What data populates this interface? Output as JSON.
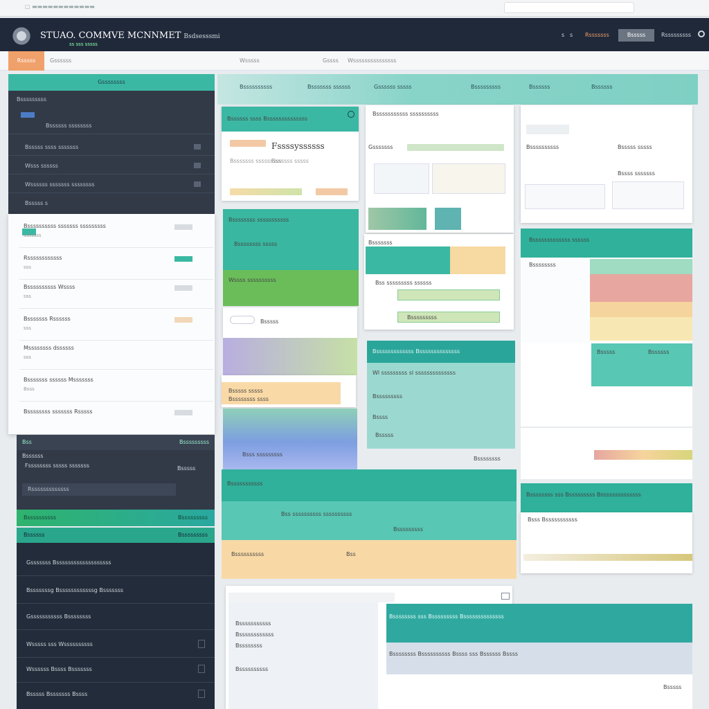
{
  "browser": {
    "url": "▢ ▬▬▬▬▬▬▬▬▬▬▬▬"
  },
  "header": {
    "title": "STUAO. COMMVE MCNNMET",
    "subtitle": "Bsdsesssmi",
    "tagline": "ss sss sssss",
    "nav": [
      "s",
      "s",
      "Rsssssss"
    ],
    "button": "Bsssss",
    "user": "Rsssssssss"
  },
  "subnav": {
    "active": "Rsssss",
    "items": [
      "Gssssss",
      "Wsssss",
      "Gssss",
      "Wsssssssssssssss"
    ]
  },
  "sidebar": {
    "header": "Gssssssss",
    "section": "Bsssssssss",
    "rows": [
      "Bssssss ssssssss",
      "Bsssss ssss sssssss",
      "Wsss ssssss",
      "Wssssss sssssss ssssssss",
      "Bsssss s"
    ],
    "list": [
      {
        "title": "Bssssssssss sssssss sssssssss",
        "sub": "sssssss"
      },
      {
        "title": "Rssssssssssss",
        "sub": "sss"
      },
      {
        "title": "Bssssssssss Wssss",
        "sub": "sss"
      },
      {
        "title": "Bsssssss Rssssss",
        "sub": "sss"
      },
      {
        "title": "Mssssssss dssssss",
        "sub": "sss"
      },
      {
        "title": "Bsssssss ssssss Msssssss",
        "sub": "Bsss"
      },
      {
        "title": "Bssssssss sssssss Rsssss",
        "sub": ""
      }
    ],
    "dark2": {
      "header": "Bss",
      "right": "Bsssssssss",
      "title": "Bssssss",
      "line": "Fssssssss sssss sssssss",
      "right2": "Bsssss",
      "field": "Rsssssssssssss"
    },
    "green1": {
      "left": "Bssssssssss",
      "right": "Bsssssssss"
    },
    "green2": {
      "left": "Bssssss",
      "right": "Bsssssssss"
    },
    "dark3": [
      "Gsssssss Bsssssssssssssssssss",
      "Bsssssssg Bssssssssssssg Bsssssss",
      "Gsssssssssss Bssssssss",
      "Wsssss sss Wssssssssss",
      "Wssssss Bssss Bsssssss",
      "Bsssss Bsssssss Bssss"
    ]
  },
  "tabs": [
    "Bssssssssss",
    "Bsssssss ssssss",
    "Gssssss sssss",
    "Bsssssssss",
    "Bssssss",
    "Bssssss"
  ],
  "cards": {
    "c1": {
      "header": "Bssssss ssss Bssssssssssssss",
      "title": "Fssssyssssss",
      "lines": [
        "Bsssssss sssssssss",
        "Bssssss sssss"
      ]
    },
    "c2": {
      "title": "Bsssssssssss ssssssssss",
      "tag": "Gsssssss"
    },
    "c3": {
      "header": "Bssssssss sssssssssss",
      "title": "Bssssssss sssss",
      "sub": "Wssss ssssssssss"
    },
    "c4": {
      "header": "Bsssssss",
      "rows": [
        "Bss sssssssss ssssss",
        "Bsssssssss"
      ]
    },
    "c5": {
      "header": "Bsssssssss ssssssss",
      "row": "Bsssssssssss ssss",
      "sub": "Bsssss"
    },
    "c6": {
      "header": "Bsssssssssssss Bssssssssssssss",
      "lines": [
        "Wl sssssssss sl ssssssssssssss",
        "Bsssssssss",
        "Bssss",
        "Bsssss"
      ],
      "foot": "Bssssssss"
    },
    "c7": {
      "header": "Bsssssssss sssssssss ssss",
      "nums": [
        "Bsss",
        "Bss"
      ]
    },
    "c8": {
      "header": "Bsssssssssss",
      "rows": [
        "Bss ssssssssss ssssssssss",
        "Bsssssssss",
        "Bssssssssss"
      ]
    },
    "c9": {
      "header": "Bssssssss",
      "rows": [
        "Bsssssssssss",
        "Bssssssssssss",
        "Bssssssss",
        "Bssssssssss"
      ]
    },
    "c10": {
      "header": "Bssssssss sss Bsssssssss Bssssssssssssss",
      "sub": "Bssssssss Bssssssssss Bssss sss Bssssss Bssss",
      "row": "Bsssss"
    },
    "c11": {
      "header": "Bsssss",
      "rows": [
        "Bsssss sssss",
        "Bssssssss ssss",
        "Bsss sssssssss",
        "Bsss Bsssssssssss"
      ]
    },
    "right1": {
      "lines": [
        "Bssssssssss",
        "Bsssss sssss",
        "Bssss sssssss"
      ]
    },
    "right2": {
      "header": "Bsssssssssssss ssssss",
      "sub": "Bssssssss"
    },
    "right3": {
      "title": "Bsssss",
      "right": "Bssssss"
    }
  },
  "colors": {
    "teal": "#3bb8a3",
    "navy": "#20293a",
    "orange": "#f0a06a",
    "green": "#2fb36e"
  }
}
